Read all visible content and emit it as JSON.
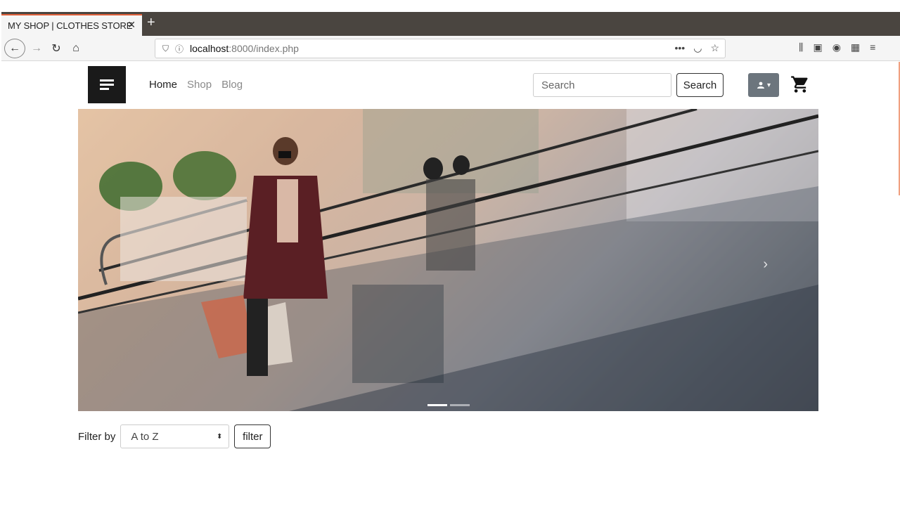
{
  "browser": {
    "tab_title": "MY SHOP | CLOTHES STORE",
    "tab_close": "✕",
    "new_tab": "+",
    "url_host": "localhost",
    "url_rest": ":8000/index.php",
    "url_more": "•••"
  },
  "header": {
    "nav": [
      {
        "label": "Home",
        "active": true
      },
      {
        "label": "Shop",
        "active": false
      },
      {
        "label": "Blog",
        "active": false
      }
    ],
    "search_placeholder": "Search",
    "search_button": "Search"
  },
  "carousel": {
    "next_arrow": "›",
    "slide_count": 2,
    "active_slide": 1
  },
  "filter": {
    "label": "Filter by",
    "selected": "A to Z",
    "button": "filter"
  },
  "colors": {
    "tab_accent": "#e0603a",
    "user_button": "#6c757d",
    "logo_bg": "#1a1a1a"
  }
}
